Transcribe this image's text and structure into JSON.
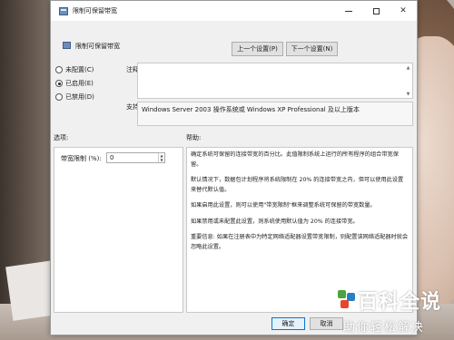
{
  "window": {
    "title": "限制可保留带宽"
  },
  "header": {
    "title": "限制可保留带宽",
    "prev_label": "上一个设置(P)",
    "next_label": "下一个设置(N)"
  },
  "state_options": [
    {
      "label": "未配置(C)",
      "checked": false
    },
    {
      "label": "已启用(E)",
      "checked": true
    },
    {
      "label": "已禁用(D)",
      "checked": false
    }
  ],
  "comment": {
    "label": "注释:",
    "value": ""
  },
  "supported": {
    "label": "支持的平台:",
    "value": "Windows Server 2003 操作系统或 Windows XP Professional 及以上版本"
  },
  "options": {
    "section_label": "选项:",
    "bandwidth_label": "带宽限制 (%):",
    "bandwidth_value": "0"
  },
  "help": {
    "section_label": "帮助:",
    "paragraphs": [
      "确定系统可保留的连接带宽的百分比。此值限制系统上运行的所有程序的组合带宽保留。",
      "默认情况下，数据包计划程序将系统限制在 20% 的连接带宽之内，但可以使用此设置来替代默认值。",
      "如果启用此设置，则可以使用\"带宽限制\"框来调整系统可保留的带宽数量。",
      "如果禁用或未配置此设置，则系统使用默认值为 20% 的连接带宽。",
      "重要信息: 如果在注册表中为特定网络适配器设置带宽限制，则配置该网络适配器时就会忽略此设置。"
    ]
  },
  "footer": {
    "ok_label": "确定",
    "cancel_label": "取消"
  },
  "watermark": {
    "title": "百科全说",
    "subtitle": "助你轻松解决"
  }
}
